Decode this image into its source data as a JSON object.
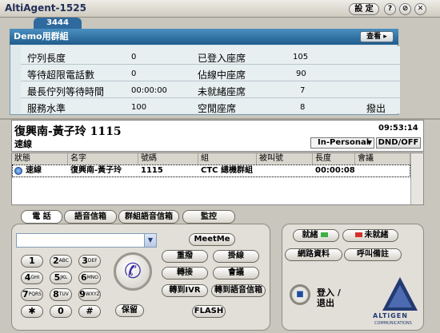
{
  "window": {
    "title": "AltiAgent-1525",
    "settings_label": "設 定",
    "help_icon": "question-icon",
    "minimize_icon": "minimize-icon",
    "close_icon": "close-icon"
  },
  "group": {
    "tab_number": "3444",
    "name": "Demo用群組",
    "view_label": "查看",
    "stats": [
      {
        "label": "佇列長度",
        "value": "0",
        "label2": "已登入座席",
        "value2": "105"
      },
      {
        "label": "等待超限電話數",
        "value": "0",
        "label2": "佔線中座席",
        "value2": "90"
      },
      {
        "label": "最長佇列等待時間",
        "value": "00:00:00",
        "label2": "未就緒座席",
        "value2": "7"
      },
      {
        "label": "服務水準",
        "value": "100",
        "label2": "空閒座席",
        "value2": "8"
      }
    ],
    "exit_label": "撥出"
  },
  "call": {
    "name": "復興南-黃子玲  1115",
    "type": "速線",
    "time": "09:53:14",
    "mode": "In-Personal",
    "dnd_label": "DND/OFF"
  },
  "table": {
    "headers": [
      "狀態",
      "名字",
      "號碼",
      "組",
      "被叫號",
      "長度",
      "會議"
    ],
    "rows": [
      [
        "速線",
        "復興南-黃子玲",
        "1115",
        "CTC 總機群組",
        "",
        "00:00:08",
        ""
      ]
    ]
  },
  "tabs": {
    "phone": "電 話",
    "voicemail": "語音信箱",
    "group_voicemail": "群組語音信箱",
    "monitor": "監控"
  },
  "phone": {
    "dial_value": "",
    "meetme": "MeetMe",
    "keys": [
      {
        "main": "1",
        "sub": "",
        "name": "key-1"
      },
      {
        "main": "2",
        "sub": "ABC",
        "name": "key-2"
      },
      {
        "main": "3",
        "sub": "DEF",
        "name": "key-3"
      },
      {
        "main": "4",
        "sub": "GHI",
        "name": "key-4"
      },
      {
        "main": "5",
        "sub": "JKL",
        "name": "key-5"
      },
      {
        "main": "6",
        "sub": "MNO",
        "name": "key-6"
      },
      {
        "main": "7",
        "sub": "PQRS",
        "name": "key-7"
      },
      {
        "main": "8",
        "sub": "TUV",
        "name": "key-8"
      },
      {
        "main": "9",
        "sub": "WXYZ",
        "name": "key-9"
      },
      {
        "main": "✱",
        "sub": "",
        "name": "key-star"
      },
      {
        "main": "0",
        "sub": "",
        "name": "key-0"
      },
      {
        "main": "#",
        "sub": "",
        "name": "key-hash"
      }
    ],
    "hold": "保留",
    "redial": "重撥",
    "hangup": "掛線",
    "transfer": "轉接",
    "conference": "會議",
    "to_ivr": "轉到IVR",
    "to_voicemail": "轉到語音信箱",
    "flash": "FLASH"
  },
  "right": {
    "ready": "就緒",
    "not_ready": "未就緒",
    "network": "網路資料",
    "wrap": "呼叫備註",
    "login": "登入 /",
    "logout": "退出",
    "logo": "ALTiGEN",
    "logo_sub": "COMMUNICATIONS"
  },
  "colors": {
    "header_blue": "#2f6a9e",
    "ready_led": "#3cb043",
    "notready_led": "#d6302b"
  }
}
